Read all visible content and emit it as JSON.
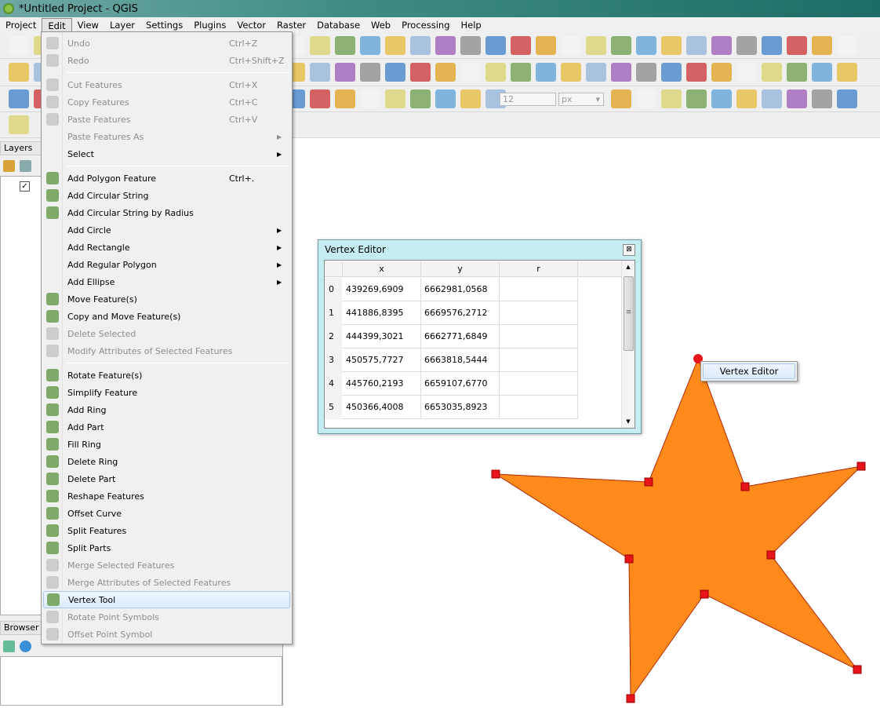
{
  "window": {
    "title": "*Untitled Project - QGIS"
  },
  "menubar": [
    "Project",
    "Edit",
    "View",
    "Layer",
    "Settings",
    "Plugins",
    "Vector",
    "Raster",
    "Database",
    "Web",
    "Processing",
    "Help"
  ],
  "colors": {
    "star_fill": "#fd8a1a",
    "star_stroke": "#b02a0a",
    "vertex": "#e8141c",
    "highlight": "#dcebfc"
  },
  "edit_menu": [
    {
      "label": "Undo",
      "shortcut": "Ctrl+Z",
      "disabled": true,
      "icon": "undo-icon"
    },
    {
      "label": "Redo",
      "shortcut": "Ctrl+Shift+Z",
      "disabled": true,
      "icon": "redo-icon"
    },
    {
      "sep": true
    },
    {
      "label": "Cut Features",
      "shortcut": "Ctrl+X",
      "disabled": true,
      "icon": "scissors-icon"
    },
    {
      "label": "Copy Features",
      "shortcut": "Ctrl+C",
      "disabled": true,
      "icon": "copy-icon"
    },
    {
      "label": "Paste Features",
      "shortcut": "Ctrl+V",
      "disabled": true,
      "icon": "paste-icon"
    },
    {
      "label": "Paste Features As",
      "disabled": true,
      "submenu": true
    },
    {
      "label": "Select",
      "submenu": true
    },
    {
      "sep": true
    },
    {
      "label": "Add Polygon Feature",
      "shortcut": "Ctrl+.",
      "icon": "add-polygon-icon"
    },
    {
      "label": "Add Circular String",
      "icon": "circular-string-icon"
    },
    {
      "label": "Add Circular String by Radius",
      "icon": "circular-string-radius-icon"
    },
    {
      "label": "Add Circle",
      "submenu": true
    },
    {
      "label": "Add Rectangle",
      "submenu": true
    },
    {
      "label": "Add Regular Polygon",
      "submenu": true
    },
    {
      "label": "Add Ellipse",
      "submenu": true
    },
    {
      "label": "Move Feature(s)",
      "icon": "move-feature-icon"
    },
    {
      "label": "Copy and Move Feature(s)",
      "icon": "copy-move-icon"
    },
    {
      "label": "Delete Selected",
      "disabled": true,
      "icon": "trash-icon"
    },
    {
      "label": "Modify Attributes of Selected Features",
      "disabled": true,
      "icon": "modify-attributes-icon"
    },
    {
      "sep": true
    },
    {
      "label": "Rotate Feature(s)",
      "icon": "rotate-feature-icon"
    },
    {
      "label": "Simplify Feature",
      "icon": "simplify-icon"
    },
    {
      "label": "Add Ring",
      "icon": "add-ring-icon"
    },
    {
      "label": "Add Part",
      "icon": "add-part-icon"
    },
    {
      "label": "Fill Ring",
      "icon": "fill-ring-icon"
    },
    {
      "label": "Delete Ring",
      "icon": "delete-ring-icon"
    },
    {
      "label": "Delete Part",
      "icon": "delete-part-icon"
    },
    {
      "label": "Reshape Features",
      "icon": "reshape-icon"
    },
    {
      "label": "Offset Curve",
      "icon": "offset-curve-icon"
    },
    {
      "label": "Split Features",
      "icon": "split-features-icon"
    },
    {
      "label": "Split Parts",
      "icon": "split-parts-icon"
    },
    {
      "label": "Merge Selected Features",
      "disabled": true,
      "icon": "merge-features-icon"
    },
    {
      "label": "Merge Attributes of Selected Features",
      "disabled": true,
      "icon": "merge-attributes-icon"
    },
    {
      "label": "Vertex Tool",
      "highlighted": true,
      "icon": "vertex-tool-icon"
    },
    {
      "label": "Rotate Point Symbols",
      "disabled": true,
      "icon": "rotate-point-icon"
    },
    {
      "label": "Offset Point Symbol",
      "disabled": true,
      "icon": "offset-point-icon"
    }
  ],
  "panels": {
    "layers": "Layers",
    "browser": "Browser"
  },
  "toolbar": {
    "snap_tolerance": "12",
    "snap_unit": "px"
  },
  "vertex_editor": {
    "title": "Vertex Editor",
    "columns": [
      "x",
      "y",
      "r"
    ],
    "rows": [
      {
        "i": "0",
        "x": "439269,6909",
        "y": "6662981,0568",
        "r": ""
      },
      {
        "i": "1",
        "x": "441886,8395",
        "y": "6669576,2712",
        "r": ""
      },
      {
        "i": "2",
        "x": "444399,3021",
        "y": "6662771,6849",
        "r": ""
      },
      {
        "i": "3",
        "x": "450575,7727",
        "y": "6663818,5444",
        "r": ""
      },
      {
        "i": "4",
        "x": "445760,2193",
        "y": "6659107,6770",
        "r": ""
      },
      {
        "i": "5",
        "x": "450366,4008",
        "y": "6653035,8923",
        "r": ""
      }
    ]
  },
  "context_menu": {
    "item": "Vertex Editor"
  }
}
